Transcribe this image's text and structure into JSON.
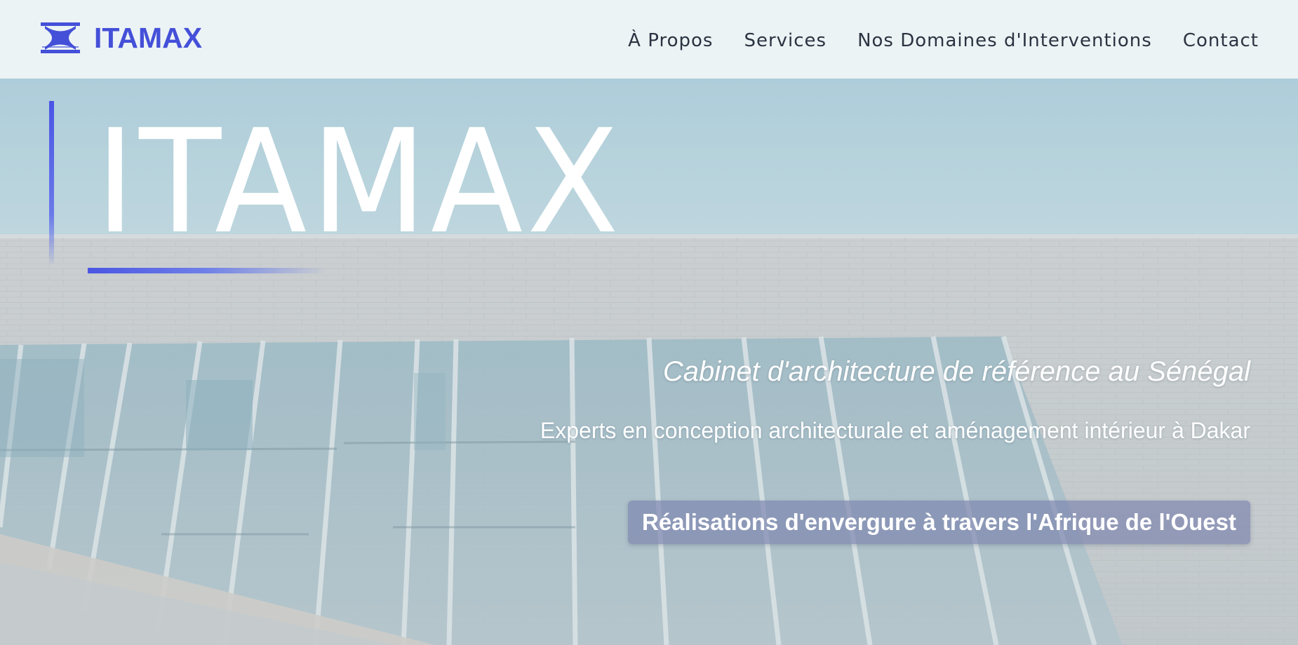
{
  "header": {
    "logo_text": "ITAMAX",
    "logo_icon": "itamax-logo-mark",
    "nav": [
      {
        "label": "À Propos"
      },
      {
        "label": "Services"
      },
      {
        "label": "Nos Domaines d'Interventions"
      },
      {
        "label": "Contact"
      }
    ]
  },
  "hero": {
    "title": "ITAMAX",
    "tagline": "Cabinet d'architecture de référence au Sénégal",
    "subtitle": "Experts en conception architecturale et aménagement intérieur à Dakar",
    "badge": "Réalisations d'envergure à travers l'Afrique de l'Ouest"
  },
  "colors": {
    "brand": "#4450d8",
    "header_bg": "#ecf3f5",
    "nav_text": "#2a3441",
    "accent": "#4a55e6"
  }
}
